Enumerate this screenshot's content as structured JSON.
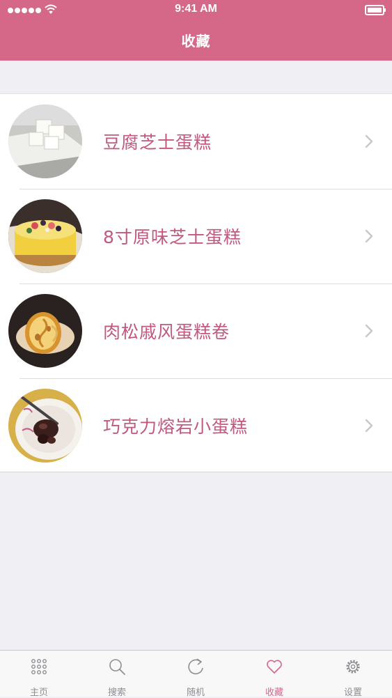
{
  "status_bar": {
    "time": "9:41 AM",
    "signal_icon": "signal-dots-icon",
    "wifi_icon": "wifi-icon",
    "battery_icon": "battery-icon"
  },
  "nav": {
    "title": "收藏"
  },
  "colors": {
    "accent": "#d56889",
    "label": "#c2577f",
    "background": "#efeff4",
    "tab_inactive": "#8e8e93"
  },
  "favorites": [
    {
      "title": "豆腐芝士蛋糕",
      "thumbnail_icon": "tofu-cheesecake-photo"
    },
    {
      "title": "8寸原味芝士蛋糕",
      "thumbnail_icon": "cheesecake-photo"
    },
    {
      "title": "肉松戚风蛋糕卷",
      "thumbnail_icon": "chiffon-roll-photo"
    },
    {
      "title": "巧克力熔岩小蛋糕",
      "thumbnail_icon": "lava-cake-photo"
    }
  ],
  "tabs": [
    {
      "label": "主页",
      "icon": "grid-icon",
      "active": false
    },
    {
      "label": "搜索",
      "icon": "search-icon",
      "active": false
    },
    {
      "label": "随机",
      "icon": "refresh-icon",
      "active": false
    },
    {
      "label": "收藏",
      "icon": "heart-icon",
      "active": true
    },
    {
      "label": "设置",
      "icon": "gear-icon",
      "active": false
    }
  ]
}
